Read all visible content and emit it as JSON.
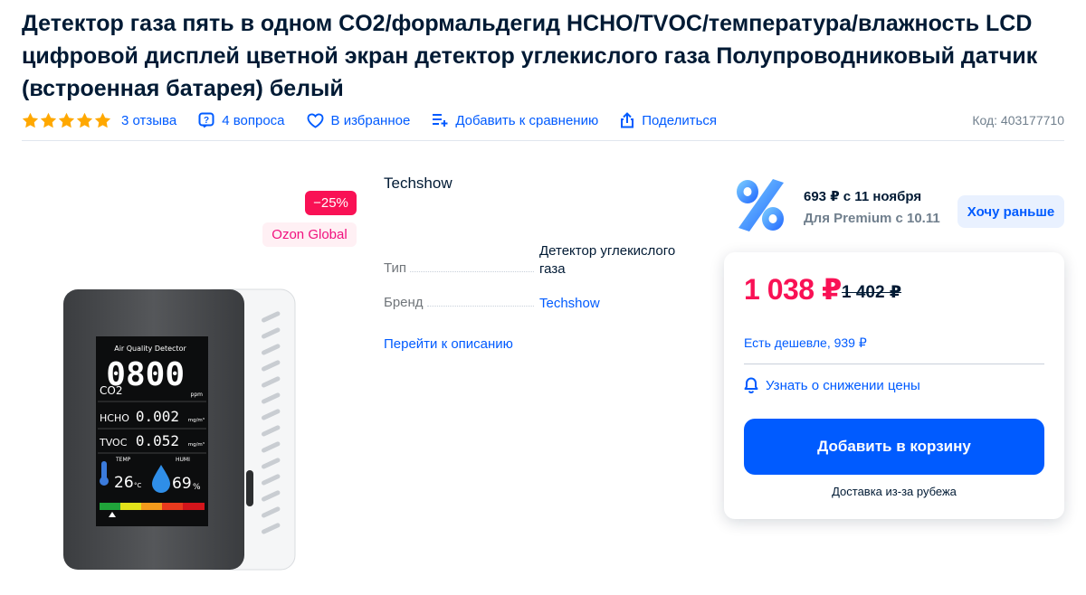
{
  "product": {
    "title": "Детектор газа пять в одном CO2/формальдегид HCHO/TVOC/температура/влажность LCD цифровой дисплей цветной экран детектор углекислого газа Полупроводниковый датчик (встроенная батарея) белый",
    "rating_stars": 5,
    "reviews": "3 отзыва",
    "questions": "4 вопроса",
    "favorite": "В избранное",
    "compare": "Добавить к сравнению",
    "share": "Поделиться",
    "code": "Код: 403177710"
  },
  "gallery": {
    "discount_badge": "−25%",
    "origin_badge": "Ozon Global",
    "screen": {
      "header": "Air Quality Detector",
      "co2_value": "0800",
      "co2_label": "CO2",
      "co2_unit": "ppm",
      "hcho_label": "HCHO",
      "hcho_value": "0.002",
      "hcho_unit": "mg/m³",
      "tvoc_label": "TVOC",
      "tvoc_value": "0.052",
      "tvoc_unit": "mg/m³",
      "temp_label": "TEMP",
      "temp_value": "26",
      "temp_unit": "°C",
      "humi_label": "HUMI",
      "humi_value": "69",
      "humi_unit": "%"
    }
  },
  "specs": {
    "brand_top": "Techshow",
    "rows": [
      {
        "key": "Тип",
        "value": "Детектор углекислого газа"
      },
      {
        "key": "Бренд",
        "value": "Techshow"
      }
    ],
    "go_to_description": "Перейти к описанию"
  },
  "buy": {
    "promo_price": "693 ₽ с 11 ноября",
    "promo_sub": "Для Premium с 10.11",
    "want_earlier": "Хочу раньше",
    "price_now": "1 038 ₽",
    "price_old": "1 402 ₽",
    "cheaper": "Есть дешевле, 939 ₽",
    "notify": "Узнать о снижении цены",
    "add_to_cart": "Добавить в корзину",
    "delivery": "Доставка из-за рубежа"
  },
  "colors": {
    "accent": "#005bff",
    "sale": "#f91155",
    "star": "#ffa800",
    "text": "#001a34"
  },
  "icons": [
    "star-icon",
    "question-icon",
    "heart-icon",
    "compare-icon",
    "share-icon",
    "percent-icon",
    "bell-icon"
  ]
}
